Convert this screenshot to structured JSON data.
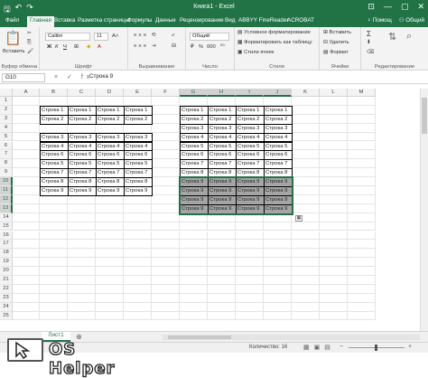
{
  "app": {
    "title": "Книга1 - Excel",
    "window_controls": {
      "minimize": "—",
      "maximize": "▢",
      "close": "✕",
      "ribbon_options": "⊡"
    }
  },
  "tabs": [
    {
      "label": "Файл"
    },
    {
      "label": "Главная",
      "active": true
    },
    {
      "label": "Вставка"
    },
    {
      "label": "Разметка страницы"
    },
    {
      "label": "Формулы"
    },
    {
      "label": "Данные"
    },
    {
      "label": "Рецензирование"
    },
    {
      "label": "Вид"
    },
    {
      "label": "ABBYY FineReader"
    },
    {
      "label": "ACROBAT"
    }
  ],
  "tabs_right": {
    "help": "Помощ",
    "share": "Общий"
  },
  "ribbon": {
    "clipboard": {
      "label": "Буфер обмена",
      "paste": "Вставить"
    },
    "font": {
      "label": "Шрифт",
      "font_name": "Calibri",
      "font_size": "11",
      "bold": "Ж",
      "italic": "К",
      "underline": "Ч"
    },
    "alignment": {
      "label": "Выравнивание"
    },
    "number": {
      "label": "Число",
      "format": "Общий",
      "percent": "%",
      "thousands": "000"
    },
    "styles": {
      "label": "Стили",
      "conditional": "Условное форматирование",
      "as_table": "Форматировать как таблицу",
      "cell_styles": "Стили ячеек"
    },
    "cells": {
      "label": "Ячейки",
      "insert": "Вставить",
      "delete": "Удалить",
      "format": "Формат"
    },
    "editing": {
      "label": "Редактирование",
      "sum": "Σ"
    }
  },
  "formula_bar": {
    "name_box": "G10",
    "icons": "× ✓ fx",
    "formula": "Строка 9"
  },
  "columns": [
    "A",
    "B",
    "C",
    "D",
    "E",
    "F",
    "G",
    "H",
    "I",
    "J",
    "K",
    "L",
    "M"
  ],
  "rows": [
    "1",
    "2",
    "3",
    "4",
    "5",
    "6",
    "7",
    "8",
    "9",
    "10",
    "11",
    "12",
    "13",
    "14",
    "15",
    "16",
    "17",
    "18",
    "19",
    "20",
    "21",
    "22",
    "23",
    "24",
    "25"
  ],
  "table_left": [
    [
      "Строка 1",
      "Строка 1",
      "Строка 1",
      "Строка 1"
    ],
    [
      "Строка 2",
      "Строка 2",
      "Строка 2",
      "Строка 2"
    ],
    null,
    [
      "Строка 3",
      "Строка 3",
      "Строка 3",
      "Строка 3"
    ],
    [
      "Строка 4",
      "Строка 4",
      "Строка 4",
      "Строка 4"
    ],
    [
      "Строка 6",
      "Строка 6",
      "Строка 6",
      "Строка 6"
    ],
    [
      "Строка 5",
      "Строка 5",
      "Строка 5",
      "Строка 5"
    ],
    [
      "Строка 7",
      "Строка 7",
      "Строка 7",
      "Строка 7"
    ],
    [
      "Строка 8",
      "Строка 8",
      "Строка 8",
      "Строка 8"
    ],
    [
      "Строка 9",
      "Строка 9",
      "Строка 9",
      "Строка 9"
    ]
  ],
  "table_right": [
    [
      "Строка 1",
      "Строка 1",
      "Строка 1",
      "Строка 1"
    ],
    [
      "Строка 2",
      "Строка 2",
      "Строка 2",
      "Строка 2"
    ],
    [
      "Строка 3",
      "Строка 3",
      "Строка 3",
      "Строка 3"
    ],
    [
      "Строка 4",
      "Строка 4",
      "Строка 4",
      "Строка 4"
    ],
    [
      "Строка 5",
      "Строка 5",
      "Строка 5",
      "Строка 5"
    ],
    [
      "Строка 6",
      "Строка 6",
      "Строка 6",
      "Строка 6"
    ],
    [
      "Строка 7",
      "Строка 7",
      "Строка 7",
      "Строка 7"
    ],
    [
      "Строка 8",
      "Строка 8",
      "Строка 8",
      "Строка 8"
    ],
    [
      "Строка 9",
      "Строка 9",
      "Строка 9",
      "Строка 9"
    ],
    [
      "Строка 9",
      "Строка 9",
      "Строка 9",
      "Строка 9"
    ],
    [
      "Строка 9",
      "Строка 9",
      "Строка 9",
      "Строка 9"
    ],
    [
      "Строка 9",
      "Строка 9",
      "Строка 9",
      "Строка 9"
    ]
  ],
  "sheet_tab": "Лист1",
  "status": {
    "count": "Количество: 16"
  },
  "watermark": {
    "brand": "OS Helper"
  },
  "colors": {
    "accent": "#217346",
    "selected_fill": "#a5a5a5"
  }
}
